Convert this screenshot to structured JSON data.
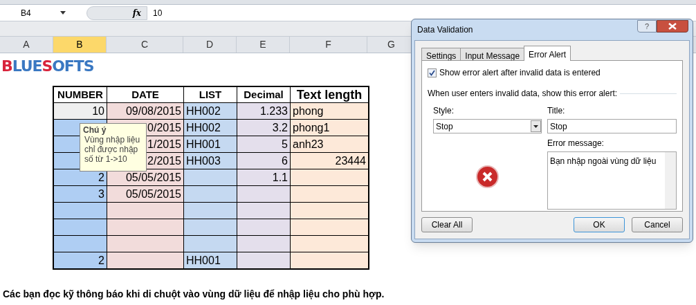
{
  "formula_bar": {
    "name_box": "B4",
    "fx": "fx",
    "value": "10"
  },
  "column_headers": [
    {
      "label": "A",
      "selected": false
    },
    {
      "label": "B",
      "selected": true
    },
    {
      "label": "C",
      "selected": false
    },
    {
      "label": "D",
      "selected": false
    },
    {
      "label": "E",
      "selected": false
    },
    {
      "label": "F",
      "selected": false
    },
    {
      "label": "G",
      "selected": false
    }
  ],
  "logo": [
    {
      "text": "B",
      "color": "#d8243c"
    },
    {
      "text": "LUE",
      "color": "#3a78c2"
    },
    {
      "text": "S",
      "color": "#d8243c"
    },
    {
      "text": "OFTS",
      "color": "#3a78c2"
    }
  ],
  "table": {
    "columns": [
      "NUMBER",
      "DATE",
      "LIST",
      "Decimal",
      "Text length"
    ],
    "rows": [
      {
        "number": "10",
        "date": "09/08/2015",
        "list": "HH002",
        "decimal": "1.233",
        "text_length": "phong",
        "number_active": true,
        "kind": "text"
      },
      {
        "date": "0/2015",
        "list": "HH002",
        "decimal": "3.2",
        "text_length": "phong1",
        "number_active": false,
        "kind": "text"
      },
      {
        "date": "1/2015",
        "list": "HH001",
        "decimal": "5",
        "text_length": "anh23",
        "number_active": false,
        "kind": "text"
      },
      {
        "date": "2/2015",
        "list": "HH003",
        "decimal": "6",
        "text_length": "23444",
        "number_active": false,
        "kind": "number"
      },
      {
        "number": "2",
        "date": "05/05/2015",
        "decimal": "1.1",
        "number_active": false
      },
      {
        "number": "3",
        "date": "05/05/2015",
        "number_active": false
      },
      {
        "number_active": false
      },
      {
        "number_active": false
      },
      {
        "number_active": false
      },
      {
        "number": "2",
        "list": "HH001",
        "number_active": false
      }
    ]
  },
  "tooltip": {
    "title": "Chú ý",
    "lines": [
      "Vùng nhập liệu",
      "chỉ được nhập",
      "số từ 1->10"
    ]
  },
  "dialog": {
    "title": "Data Validation",
    "help": "?",
    "tabs": [
      {
        "label": "Settings",
        "selected": false
      },
      {
        "label": "Input Message",
        "selected": false
      },
      {
        "label": "Error Alert",
        "selected": true
      }
    ],
    "show_alert": {
      "label": "Show error alert after invalid data is entered",
      "checked": true
    },
    "section": "When user enters invalid data, show this error alert:",
    "style": {
      "label": "Style:",
      "value": "Stop"
    },
    "title_field": {
      "label": "Title:",
      "value": "Stop"
    },
    "message": {
      "label": "Error message:",
      "value": "Bạn nhập ngoài vùng dữ liệu"
    },
    "buttons": [
      {
        "label": "Clear All",
        "default": false
      },
      {
        "label": "OK",
        "default": true
      },
      {
        "label": "Cancel",
        "default": false
      }
    ]
  },
  "caption": "Các bạn đọc kỹ thông báo khi di chuột vào vùng dữ liệu để nhập liệu cho phù hợp."
}
